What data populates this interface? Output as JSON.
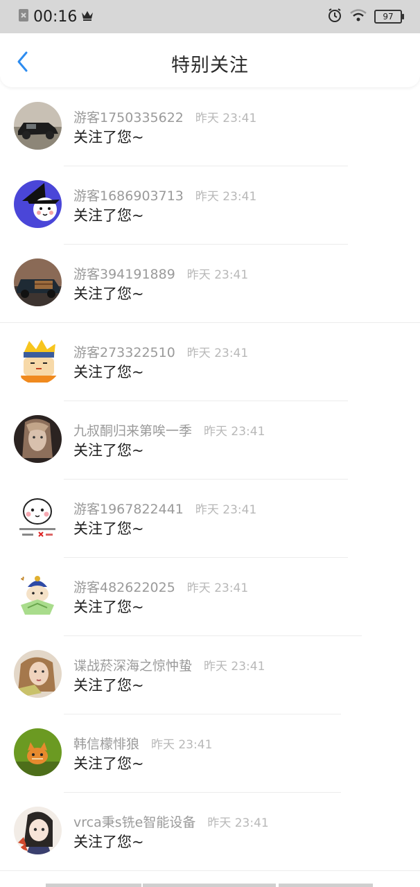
{
  "status_bar": {
    "time": "00:16",
    "battery": "97",
    "icons": [
      "screenshot-icon",
      "crown-icon",
      "alarm-icon",
      "wifi-icon",
      "battery-icon"
    ]
  },
  "header": {
    "title": "特别关注",
    "back_icon": "chevron-left-icon",
    "accent_color": "#2d8cf0"
  },
  "list": {
    "items": [
      {
        "name": "游客1750335622",
        "time": "昨天 23:41",
        "message": "关注了您~",
        "avatar": "vintage-car"
      },
      {
        "name": "游客1686903713",
        "time": "昨天 23:41",
        "message": "关注了您~",
        "avatar": "witch-cartoon"
      },
      {
        "name": "游客394191889",
        "time": "昨天 23:41",
        "message": "关注了您~",
        "avatar": "woody-car"
      },
      {
        "name": "游客273322510",
        "time": "昨天 23:41",
        "message": "关注了您~",
        "avatar": "ninja-cartoon"
      },
      {
        "name": "九叔酮归来第唉一季",
        "time": "昨天 23:41",
        "message": "关注了您~",
        "avatar": "woman-photo"
      },
      {
        "name": "游客1967822441",
        "time": "昨天 23:41",
        "message": "关注了您~",
        "avatar": "blob-sticker"
      },
      {
        "name": "游客482622025",
        "time": "昨天 23:41",
        "message": "关注了您~",
        "avatar": "qing-cartoon"
      },
      {
        "name": "谍战菸深海之惊忡蛰",
        "time": "昨天 23:41",
        "message": "关注了您~",
        "avatar": "woman-selfie"
      },
      {
        "name": "韩信檬悱狼",
        "time": "昨天 23:41",
        "message": "关注了您~",
        "avatar": "kitten-photo"
      },
      {
        "name": "vrca秉s铣e智能设备",
        "time": "昨天 23:41",
        "message": "关注了您~",
        "avatar": "anime-girl"
      }
    ]
  }
}
